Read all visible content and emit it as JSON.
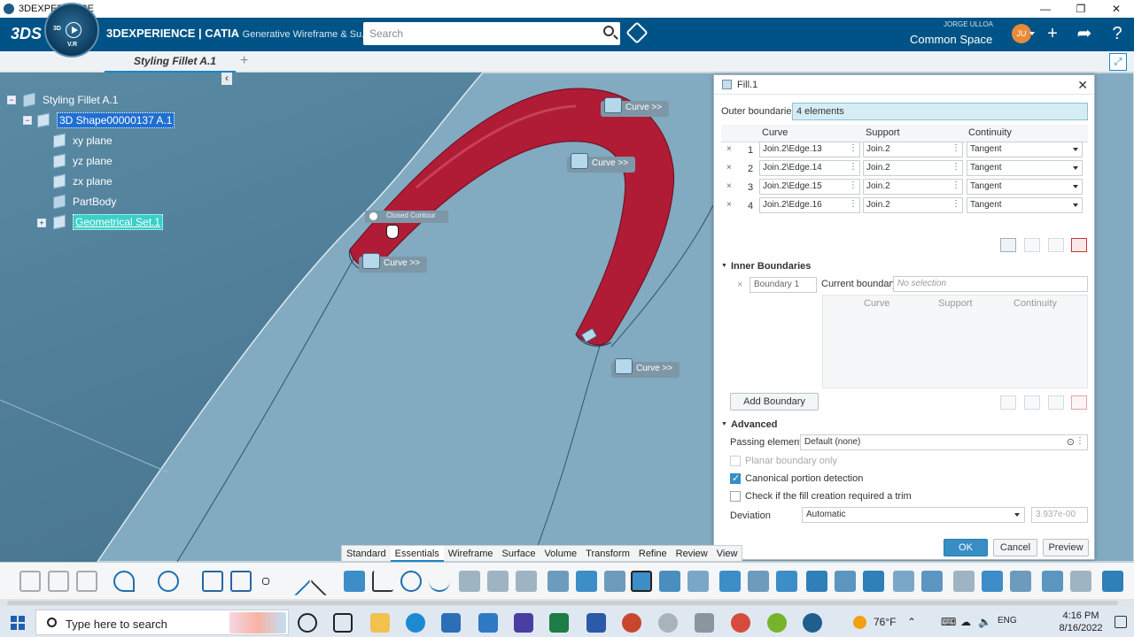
{
  "window": {
    "title": "3DEXPERIENCE",
    "minimize_glyph": "—",
    "restore_glyph": "❐",
    "close_glyph": "✕"
  },
  "header": {
    "logo_text": "3DS",
    "compass_3d": "3D",
    "compass_vr": "V.R",
    "brand_main": "3DEXPERIENCE | CATIA",
    "brand_sub": "Generative Wireframe & Su...",
    "search_placeholder": "Search",
    "user_name": "JORGE ULLOA",
    "space": "Common Space",
    "avatar_initials": "JU",
    "icons": [
      "tag-icon",
      "plus-icon",
      "share-icon",
      "help-icon"
    ],
    "accent_color": "#005386"
  },
  "tabs": {
    "active": "Styling Fillet A.1",
    "add_glyph": "+"
  },
  "tree": {
    "root": "Styling Fillet A.1",
    "shape": "3D Shape00000137 A.1",
    "children": [
      "xy plane",
      "yz plane",
      "zx plane",
      "PartBody",
      "Geometrical Set.1"
    ],
    "collapse_glyph": "‹"
  },
  "viewport": {
    "curve_label": "Curve >>",
    "closed_contour": "Closed Contour",
    "fill_color": "#b01b36",
    "surface_color": "#7fa8bf"
  },
  "dialog": {
    "title": "Fill.1",
    "outer_boundaries_label": "Outer boundaries",
    "outer_boundaries_value": "4 elements",
    "columns": [
      "Curve",
      "Support",
      "Continuity"
    ],
    "rows": [
      {
        "n": "1",
        "curve": "Join.2\\Edge.13",
        "support": "Join.2",
        "continuity": "Tangent"
      },
      {
        "n": "2",
        "curve": "Join.2\\Edge.14",
        "support": "Join.2",
        "continuity": "Tangent"
      },
      {
        "n": "3",
        "curve": "Join.2\\Edge.15",
        "support": "Join.2",
        "continuity": "Tangent"
      },
      {
        "n": "4",
        "curve": "Join.2\\Edge.16",
        "support": "Join.2",
        "continuity": "Tangent"
      }
    ],
    "inner_boundaries": "Inner Boundaries",
    "boundary_1": "Boundary 1",
    "current_boundary_label": "Current boundary",
    "current_boundary_placeholder": "No selection",
    "add_boundary": "Add Boundary",
    "advanced": "Advanced",
    "passing_elements_label": "Passing elements",
    "passing_elements_value": "Default (none)",
    "planar_boundary_only": "Planar boundary only",
    "canonical_detection": "Canonical portion detection",
    "check_trim": "Check if the fill creation required a trim",
    "deviation_label": "Deviation",
    "deviation_value": "Automatic",
    "deviation_number": "3.937e-00",
    "ok": "OK",
    "cancel": "Cancel",
    "preview": "Preview",
    "row_delete_glyph": "×",
    "kebab_glyph": "⋮",
    "close_glyph": "✕"
  },
  "command_tabs": [
    "Standard",
    "Essentials",
    "Wireframe",
    "Surface",
    "Volume",
    "Transform",
    "Refine",
    "Review",
    "View"
  ],
  "taskbar": {
    "search_text": "Type here to search",
    "temperature": "76°F",
    "time": "4:16 PM",
    "date": "8/16/2022",
    "tray_glyphs": [
      "⌃",
      "⌨",
      "☁",
      "🔈",
      "ENG"
    ]
  }
}
